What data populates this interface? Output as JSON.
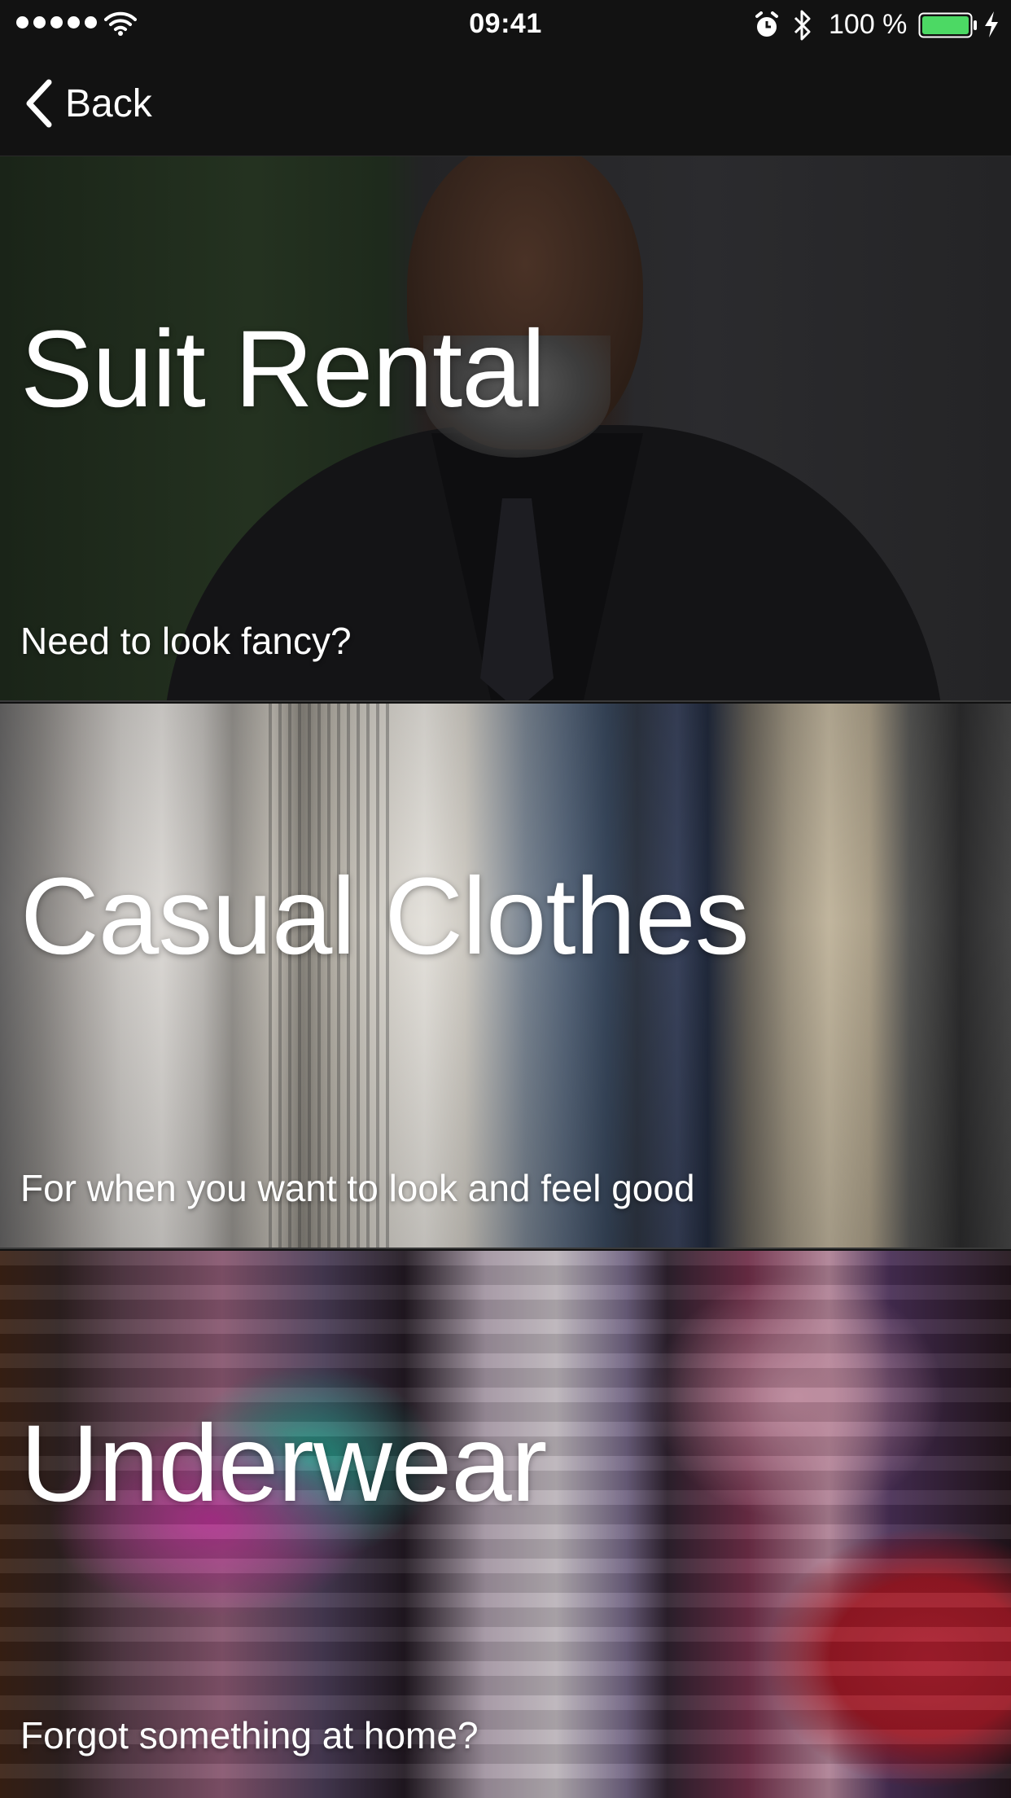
{
  "status_bar": {
    "time": "09:41",
    "battery_percent": "100 %",
    "battery_color": "#4cd964",
    "icons": [
      "signal-dots-icon",
      "wifi-icon",
      "alarm-icon",
      "bluetooth-icon",
      "battery-icon",
      "charging-bolt-icon"
    ]
  },
  "nav": {
    "back_label": "Back",
    "back_icon": "chevron-left-icon"
  },
  "categories": [
    {
      "title": "Suit Rental",
      "subtitle": "Need to look fancy?"
    },
    {
      "title": "Casual Clothes",
      "subtitle": "For when you want to look and feel good"
    },
    {
      "title": "Underwear",
      "subtitle": "Forgot something at home?"
    }
  ]
}
